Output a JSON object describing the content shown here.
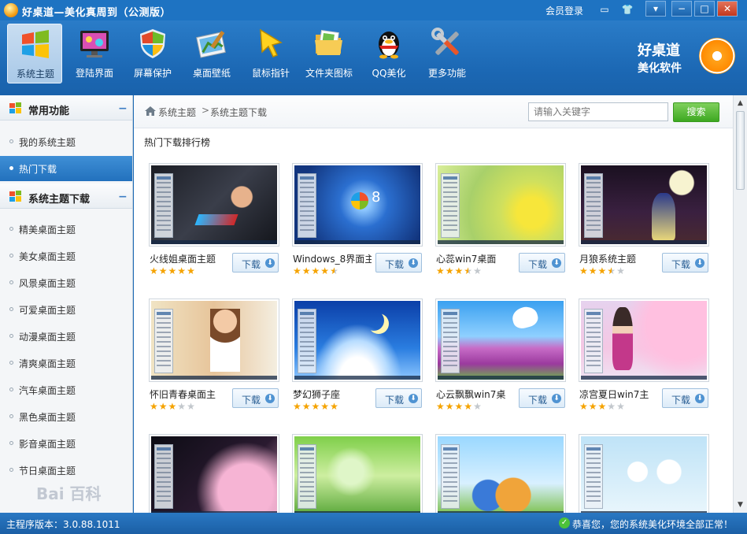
{
  "window": {
    "title": "好桌道—美化真周到（公测版）",
    "login": "会员登录"
  },
  "toolbar": {
    "items": [
      {
        "label": "系统主题",
        "icon": "windows-logo-icon",
        "active": true
      },
      {
        "label": "登陆界面",
        "icon": "monitor-icon"
      },
      {
        "label": "屏幕保护",
        "icon": "shield-icon"
      },
      {
        "label": "桌面壁纸",
        "icon": "wallpaper-icon"
      },
      {
        "label": "鼠标指针",
        "icon": "cursor-icon"
      },
      {
        "label": "文件夹图标",
        "icon": "folder-icon"
      },
      {
        "label": "QQ美化",
        "icon": "qq-penguin-icon"
      },
      {
        "label": "更多功能",
        "icon": "tools-icon"
      }
    ],
    "brand_line1": "好桌道",
    "brand_line2": "美化软件"
  },
  "sidebar": {
    "group1": {
      "title": "常用功能",
      "collapse": "−"
    },
    "group1_items": [
      "我的系统主题",
      "热门下载"
    ],
    "group2": {
      "title": "系统主题下载",
      "collapse": "−"
    },
    "group2_items": [
      "精美桌面主题",
      "美女桌面主题",
      "风景桌面主题",
      "可爱桌面主题",
      "动漫桌面主题",
      "清爽桌面主题",
      "汽车桌面主题",
      "黑色桌面主题",
      "影音桌面主题",
      "节日桌面主题"
    ],
    "watermark": "Bai 百科"
  },
  "breadcrumb": {
    "root": "系统主题",
    "sep": ">",
    "current": "系统主题下载"
  },
  "search": {
    "placeholder": "请输入关键字",
    "button": "搜索"
  },
  "section_title": "热门下载排行榜",
  "download_label": "下载",
  "themes": [
    {
      "title": "火线姐桌面主题",
      "rating": 5
    },
    {
      "title": "Windows_8界面主",
      "rating": 4.5
    },
    {
      "title": "心蕊win7桌面",
      "rating": 3.5
    },
    {
      "title": "月狼系统主题",
      "rating": 3.5
    },
    {
      "title": "怀旧青春桌面主",
      "rating": 3
    },
    {
      "title": "梦幻狮子座",
      "rating": 5
    },
    {
      "title": "心云飘飘win7桌",
      "rating": 4
    },
    {
      "title": "凉宫夏日win7主",
      "rating": 3
    },
    {
      "title": "",
      "rating": 0
    },
    {
      "title": "",
      "rating": 0
    },
    {
      "title": "",
      "rating": 0
    },
    {
      "title": "",
      "rating": 0
    }
  ],
  "status": {
    "version": "主程序版本：3.0.88.1011",
    "message": "恭喜您，您的系统美化环境全部正常！"
  },
  "colors": {
    "frame_blue": "#1e73c2",
    "search_green": "#3da821",
    "star": "#f5a300"
  }
}
